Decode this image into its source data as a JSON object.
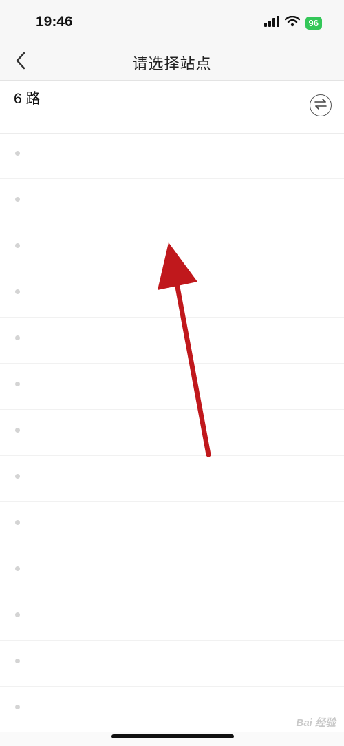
{
  "status_bar": {
    "time": "19:46",
    "battery": "96",
    "icons": [
      "cellular-signal-icon",
      "wifi-icon",
      "battery-icon"
    ]
  },
  "nav": {
    "back_icon": "chevron-left-icon",
    "title": "请选择站点"
  },
  "route": {
    "name": "6 路",
    "direction": "",
    "swap_icon": "swap-direction-icon"
  },
  "stops": [
    {
      "name": ""
    },
    {
      "name": ""
    },
    {
      "name": ""
    },
    {
      "name": ""
    },
    {
      "name": ""
    },
    {
      "name": ""
    },
    {
      "name": ""
    },
    {
      "name": ""
    },
    {
      "name": ""
    },
    {
      "name": ""
    },
    {
      "name": ""
    },
    {
      "name": ""
    },
    {
      "name": ""
    }
  ],
  "annotation": {
    "type": "arrow",
    "color": "#c0181c"
  },
  "watermark": "Bai 经验",
  "colors": {
    "battery_green": "#34c759",
    "annotation_red": "#c0181c",
    "text_dark": "#222222"
  }
}
